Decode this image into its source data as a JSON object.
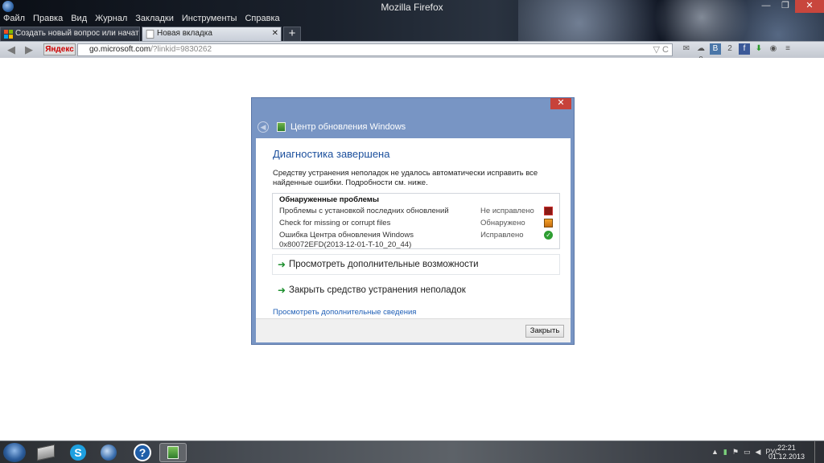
{
  "window": {
    "title": "Mozilla Firefox",
    "min": "—",
    "max": "❐",
    "close": "✕"
  },
  "menu": [
    "Файл",
    "Правка",
    "Вид",
    "Журнал",
    "Закладки",
    "Инструменты",
    "Справка"
  ],
  "tabs": [
    {
      "label": "Создать новый вопрос или начать ...",
      "active": false
    },
    {
      "label": "Новая вкладка",
      "active": true
    }
  ],
  "newtab_label": "+",
  "nav": {
    "back": "◀",
    "forward": "▶",
    "yandex_label": "Яндекс",
    "url_host": "go.microsoft.com",
    "url_path": "/?linkid=9830262",
    "reload": "▽ C"
  },
  "toolbar_icons": [
    "mail-icon",
    "weather-icon",
    "vk-icon",
    "facebook-icon",
    "download-icon",
    "addon-icon",
    "menu-icon"
  ],
  "toolbar_text": {
    "weather": "☁0",
    "vk": "B",
    "vk_count": "2",
    "fb": "f"
  },
  "dialog": {
    "close": "✕",
    "header_title": "Центр обновления Windows",
    "heading": "Диагностика завершена",
    "description": "Средству устранения неполадок не удалось автоматически исправить все найденные ошибки. Подробности см. ниже.",
    "problems_title": "Обнаруженные проблемы",
    "problems": [
      {
        "name": "Проблемы с установкой последних обновлений",
        "status": "Не исправлено",
        "icon": "error"
      },
      {
        "name": "Check for missing or corrupt files",
        "status": "Обнаружено",
        "icon": "warning"
      },
      {
        "name": "Ошибка Центра обновления Windows",
        "name2": "0x80072EFD(2013-12-01-T-10_20_44)",
        "status": "Исправлено",
        "icon": "ok"
      }
    ],
    "action1": "Просмотреть дополнительные возможности",
    "action2": "Закрыть средство устранения неполадок",
    "details_link": "Просмотреть дополнительные сведения",
    "close_button": "Закрыть"
  },
  "taskbar": {
    "items": [
      "explorer-icon",
      "skype-icon",
      "firefox-icon",
      "help-icon",
      "windows-update-icon"
    ],
    "lang": "РУС",
    "time": "22:21",
    "date": "01.12.2013"
  },
  "colors": {
    "accent": "#1b4f9c",
    "dialog_frame": "#7895c4",
    "close_red": "#c7423a"
  }
}
